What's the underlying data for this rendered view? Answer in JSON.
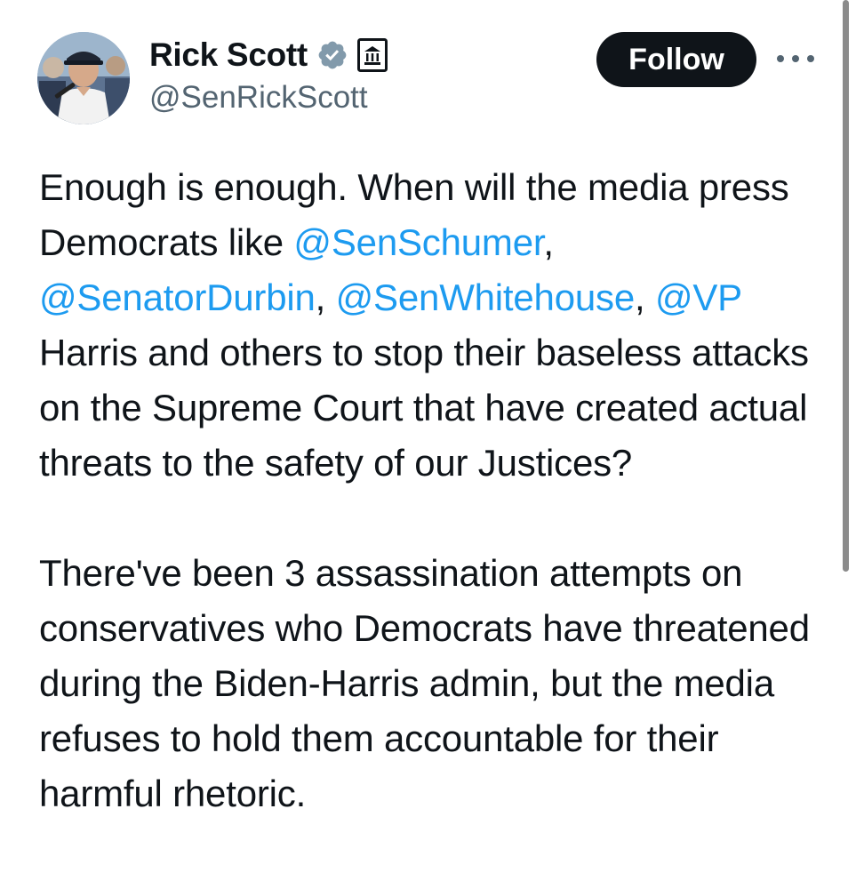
{
  "author": {
    "display_name": "Rick Scott",
    "handle": "@SenRickScott",
    "verified_icon": "verified-badge-icon",
    "affiliation_icon": "government-building-icon",
    "avatar": "profile-photo"
  },
  "actions": {
    "follow_label": "Follow",
    "more_icon": "more-options-icon"
  },
  "tweet": {
    "p1": {
      "t1": "Enough is enough. When will the media press Democrats like ",
      "m1": "@SenSchumer",
      "t2": ", ",
      "m2": "@SenatorDurbin",
      "t3": ", ",
      "m3": "@SenWhitehouse",
      "t4": ", ",
      "m4": "@VP",
      "t5": " Harris and others to stop their baseless attacks on the Supreme Court that have created actual threats to the safety of our Justices?"
    },
    "p2": "There've been 3 assassination attempts on conservatives who Democrats have threatened during the Biden-Harris admin, but the media refuses to hold them accountable for their harmful rhetoric."
  },
  "colors": {
    "text": "#0f1419",
    "secondary": "#536471",
    "link": "#1d9bf0",
    "verified": "#829aab"
  }
}
